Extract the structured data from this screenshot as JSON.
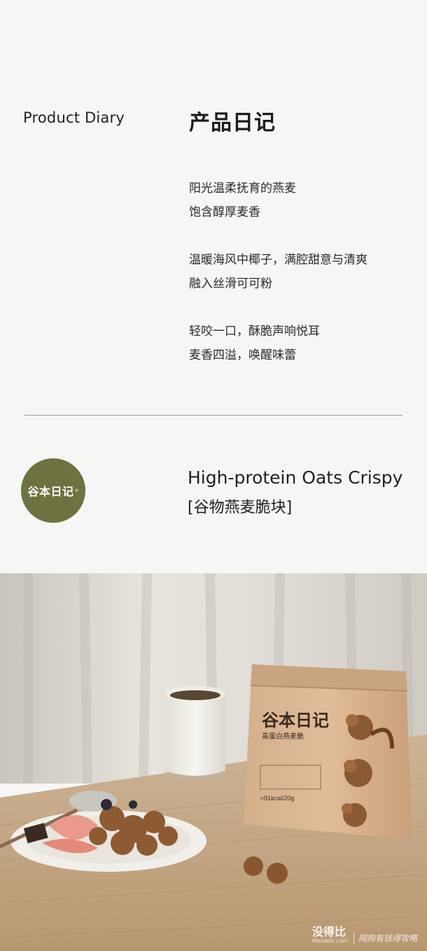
{
  "header": {
    "title_en": "Product Diary",
    "title_cn": "产品日记"
  },
  "paragraphs": [
    {
      "line1": "阳光温柔抚育的燕麦",
      "line2": "饱含醇厚麦香"
    },
    {
      "line1": "温暖海风中椰子，满腔甜意与清爽",
      "line2": "融入丝滑可可粉"
    },
    {
      "line1": "轻咬一口，酥脆声响悦耳",
      "line2": "麦香四溢，唤醒味蕾"
    }
  ],
  "brand": {
    "logo_text": "谷本日记",
    "registered": "®",
    "color": "#6f7140"
  },
  "product": {
    "name_en": "High-protein Oats Crispy",
    "name_cn": "[谷物燕麦脆块]"
  },
  "package": {
    "brand": "谷本日记",
    "subtitle": "高蛋白燕麦脆",
    "calories": "≈91kcal/20g"
  },
  "watermark": {
    "main": "没得比",
    "sub": "Meidebi.com",
    "slogan": "网购有钱得攻略"
  }
}
